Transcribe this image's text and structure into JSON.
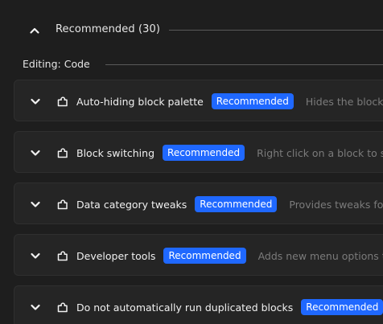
{
  "section": {
    "title": "Recommended (30)",
    "chevron_icon": "chevron-up-icon"
  },
  "category": {
    "label": "Editing: Code"
  },
  "colors": {
    "background": "#1e1e1e",
    "card_background": "#252525",
    "badge": "#1f68ff",
    "description_text": "#7b7b7b"
  },
  "addons": [
    {
      "name": "Auto-hiding block palette",
      "badge": "Recommended",
      "description": "Hides the block"
    },
    {
      "name": "Block switching",
      "badge": "Recommended",
      "description": "Right click on a block to sw"
    },
    {
      "name": "Data category tweaks",
      "badge": "Recommended",
      "description": "Provides tweaks for"
    },
    {
      "name": "Developer tools",
      "badge": "Recommended",
      "description": "Adds new menu options to"
    },
    {
      "name": "Do not automatically run duplicated blocks",
      "badge": "Recommended",
      "description": ""
    }
  ]
}
